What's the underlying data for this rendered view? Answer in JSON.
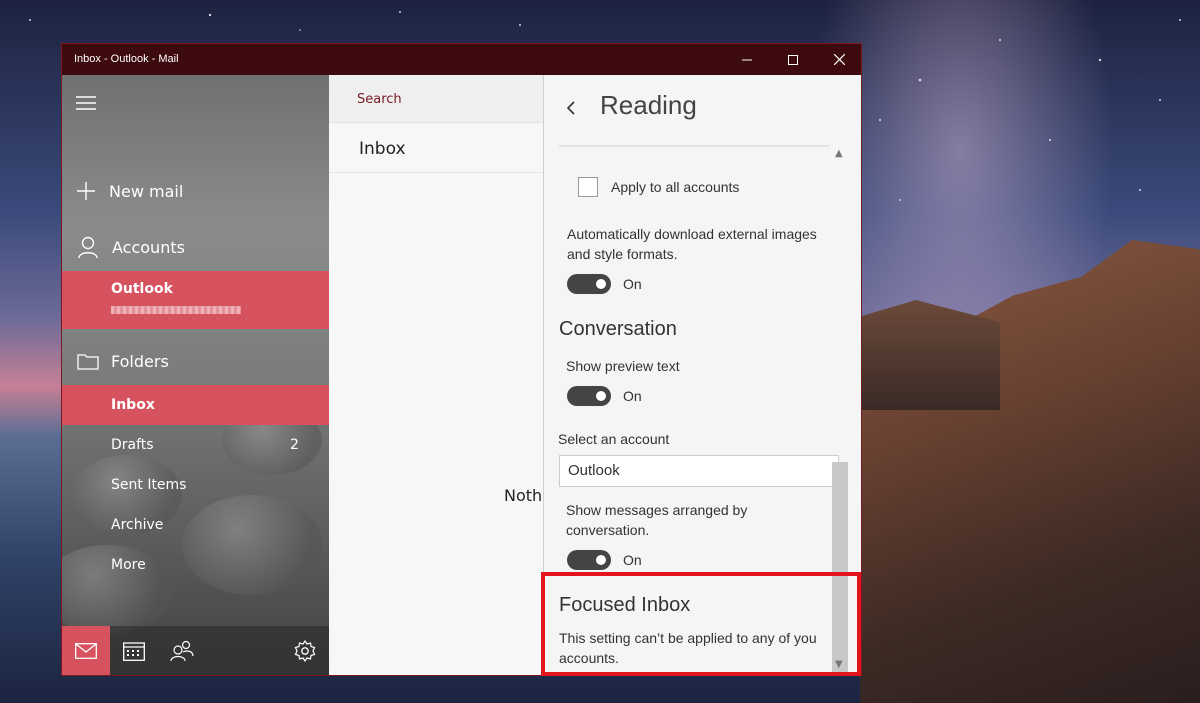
{
  "window": {
    "title": "Inbox - Outlook - Mail"
  },
  "sidebar": {
    "new_mail": "New mail",
    "accounts": "Accounts",
    "account_name": "Outlook",
    "folders": "Folders",
    "folder_items": [
      {
        "label": "Inbox",
        "count": ""
      },
      {
        "label": "Drafts",
        "count": "2"
      },
      {
        "label": "Sent Items",
        "count": ""
      },
      {
        "label": "Archive",
        "count": ""
      },
      {
        "label": "More",
        "count": ""
      }
    ]
  },
  "middle": {
    "search_label": "Search",
    "inbox_title": "Inbox",
    "empty_text": "Noth"
  },
  "panel": {
    "title": "Reading",
    "apply_all": "Apply to all accounts",
    "auto_download": "Automatically download external images and style formats.",
    "auto_download_state": "On",
    "conversation_title": "Conversation",
    "preview_text": "Show preview text",
    "preview_state": "On",
    "select_account_label": "Select an account",
    "selected_account": "Outlook",
    "arranged_label": "Show messages arranged by conversation.",
    "arranged_state": "On",
    "focused_title": "Focused Inbox",
    "focused_desc": "This setting can’t be applied to any of you accounts."
  },
  "colors": {
    "accent": "#d6525f",
    "titlebar": "#3d0a0d",
    "highlight_border": "#e3141c"
  },
  "icons": [
    "hamburger-icon",
    "plus-icon",
    "person-icon",
    "folder-icon",
    "mail-icon",
    "calendar-icon",
    "people-icon",
    "gear-icon",
    "back-chevron-icon",
    "minimize-icon",
    "maximize-icon",
    "close-icon"
  ]
}
